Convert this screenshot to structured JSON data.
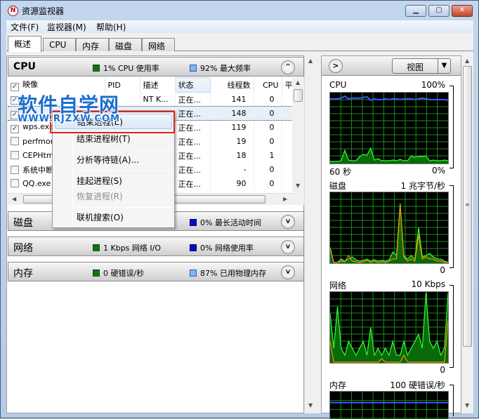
{
  "window": {
    "title": "资源监视器",
    "controls": {
      "minimize": "▁",
      "maximize": "▢",
      "close": "✕"
    }
  },
  "menubar": [
    "文件(F)",
    "监视器(M)",
    "帮助(H)"
  ],
  "tabs": [
    {
      "label": "概述",
      "active": true
    },
    {
      "label": "CPU",
      "active": false
    },
    {
      "label": "内存",
      "active": false
    },
    {
      "label": "磁盘",
      "active": false
    },
    {
      "label": "网络",
      "active": false
    }
  ],
  "cpu_section": {
    "title": "CPU",
    "stat1": "1% CPU 使用率",
    "stat2": "92% 最大频率",
    "toggle": "^",
    "columns": [
      "映像",
      "PID",
      "描述",
      "状态",
      "线程数",
      "CPU",
      "平"
    ],
    "rows": [
      {
        "checked": true,
        "image": "",
        "pid": "",
        "desc": "NT K...",
        "status": "正在...",
        "threads": "141",
        "cpu": "0",
        "selected": false
      },
      {
        "checked": true,
        "image": "",
        "pid": "",
        "desc": "",
        "status": "正在...",
        "threads": "148",
        "cpu": "0",
        "selected": true
      },
      {
        "checked": true,
        "image": "wps.exe",
        "pid": "",
        "desc": "",
        "status": "正在...",
        "threads": "119",
        "cpu": "0",
        "selected": false
      },
      {
        "checked": false,
        "image": "perfmon",
        "pid": "",
        "desc": "",
        "status": "正在...",
        "threads": "19",
        "cpu": "0",
        "selected": false
      },
      {
        "checked": false,
        "image": "CEPHtm",
        "pid": "",
        "desc": "",
        "status": "正在...",
        "threads": "18",
        "cpu": "1",
        "selected": false
      },
      {
        "checked": false,
        "image": "系统中断",
        "pid": "",
        "desc": "",
        "status": "正在...",
        "threads": "-",
        "cpu": "0",
        "selected": false
      },
      {
        "checked": false,
        "image": "QQ.exe",
        "pid": "",
        "desc": "",
        "status": "正在...",
        "threads": "90",
        "cpu": "0",
        "selected": false
      }
    ]
  },
  "disk_section": {
    "title": "磁盘",
    "stat1": "",
    "stat2": "0% 最长活动时间",
    "toggle": "v"
  },
  "network_section": {
    "title": "网络",
    "stat1": "1 Kbps 网络 I/O",
    "stat2": "0% 网络使用率",
    "toggle": "v"
  },
  "memory_section": {
    "title": "内存",
    "stat1": "0 硬错误/秒",
    "stat2": "87% 已用物理内存",
    "toggle": "v"
  },
  "context_menu": [
    {
      "label": "结束进程(E)",
      "highlighted": true,
      "disabled": false
    },
    {
      "label": "结束进程树(T)",
      "highlighted": false,
      "disabled": false
    },
    {
      "label": "分析等待链(A)...",
      "highlighted": false,
      "disabled": false
    },
    {
      "label": "挂起进程(S)",
      "highlighted": false,
      "disabled": false
    },
    {
      "label": "恢复进程(R)",
      "highlighted": false,
      "disabled": true
    },
    {
      "label": "联机搜索(O)",
      "highlighted": false,
      "disabled": false
    }
  ],
  "watermark": {
    "title": "软件自学网",
    "url": "WWW.RJZXW.COM"
  },
  "right_panel": {
    "expand": ">",
    "view_label": "视图",
    "graphs": [
      {
        "title": "CPU",
        "max": "100%",
        "min": "0%",
        "time": "60 秒"
      },
      {
        "title": "磁盘",
        "max": "1 兆字节/秒",
        "min": "0",
        "time": ""
      },
      {
        "title": "网络",
        "max": "10 Kbps",
        "min": "0",
        "time": ""
      },
      {
        "title": "内存",
        "max": "100 硬错误/秒",
        "min": "",
        "time": ""
      }
    ]
  },
  "colors": {
    "graph_grid": "#1a8f1a",
    "series_green": "#33ff33",
    "series_orange": "#ff8c00",
    "series_blue": "#3b5cff",
    "highlight_box": "#e02020",
    "watermark": "#1d6fcf"
  },
  "chart_data": [
    {
      "type": "line",
      "title": "CPU",
      "ylim": [
        0,
        100
      ],
      "xlabel": "60 秒",
      "series": [
        {
          "name": "最大频率",
          "color": "blue",
          "values": [
            92,
            92,
            92,
            93,
            96,
            92,
            93,
            93,
            93,
            94,
            95,
            90,
            92,
            91,
            91,
            92,
            91,
            92,
            92,
            91,
            92,
            92,
            92,
            91,
            92,
            93,
            92,
            91,
            91,
            91,
            91,
            91,
            90
          ]
        },
        {
          "name": "CPU 使用率",
          "color": "green",
          "values": [
            2,
            2,
            2,
            3,
            18,
            4,
            3,
            3,
            9,
            12,
            11,
            21,
            4,
            6,
            3,
            3,
            3,
            4,
            3,
            5,
            3,
            3,
            10,
            8,
            9,
            9,
            10,
            3,
            4,
            3,
            3,
            4,
            3
          ]
        }
      ]
    },
    {
      "type": "line",
      "title": "磁盘",
      "ylim": [
        0,
        1
      ],
      "series": [
        {
          "name": "green",
          "color": "green",
          "values": [
            0.2,
            0,
            0,
            0.05,
            0.02,
            0.05,
            0.08,
            0.04,
            0.02,
            0.03,
            0.05,
            0.02,
            0.04,
            0.02,
            0.03,
            0.02,
            0.04,
            0.15,
            0.1,
            0.85,
            0.1,
            0.05,
            0.1,
            0.05,
            0.5,
            0.08,
            0.1,
            0.13,
            0.08,
            0.05,
            0.05,
            0.02,
            0
          ]
        },
        {
          "name": "orange",
          "color": "orange",
          "values": [
            0.22,
            0,
            0,
            0.02,
            0.01,
            0.1,
            0.02,
            0.01,
            0,
            0.01,
            0.03,
            0,
            0.02,
            0,
            0.01,
            0,
            0.02,
            0.05,
            0.05,
            0.82,
            0.08,
            0.02,
            0.05,
            0.02,
            0.4,
            0.05,
            0.08,
            0.05,
            0.05,
            0.02,
            0.02,
            0,
            0
          ]
        }
      ]
    },
    {
      "type": "area",
      "title": "网络",
      "ylim": [
        0,
        10
      ],
      "series": [
        {
          "name": "green",
          "color": "green",
          "values": [
            7,
            2,
            8,
            2,
            1,
            3,
            2,
            1,
            2,
            3,
            1,
            5,
            1,
            2,
            1,
            2,
            1,
            3,
            1,
            1,
            3,
            1,
            2,
            3,
            4,
            2,
            10,
            3,
            2,
            3,
            1,
            2,
            10
          ]
        },
        {
          "name": "orange",
          "color": "orange",
          "values": [
            3,
            0,
            0,
            0,
            0,
            0,
            0,
            0,
            0,
            0,
            0,
            0,
            0,
            0,
            0.5,
            0,
            0,
            0,
            0,
            0,
            1,
            0,
            0,
            0,
            0,
            0,
            0,
            0,
            0,
            0,
            0,
            0,
            6
          ]
        }
      ]
    },
    {
      "type": "line",
      "title": "内存",
      "ylim": [
        0,
        100
      ],
      "series": [
        {
          "name": "已用物理内存",
          "color": "blue",
          "values": [
            87,
            87,
            87,
            87,
            87,
            87,
            87,
            87,
            87,
            87
          ]
        }
      ]
    }
  ]
}
